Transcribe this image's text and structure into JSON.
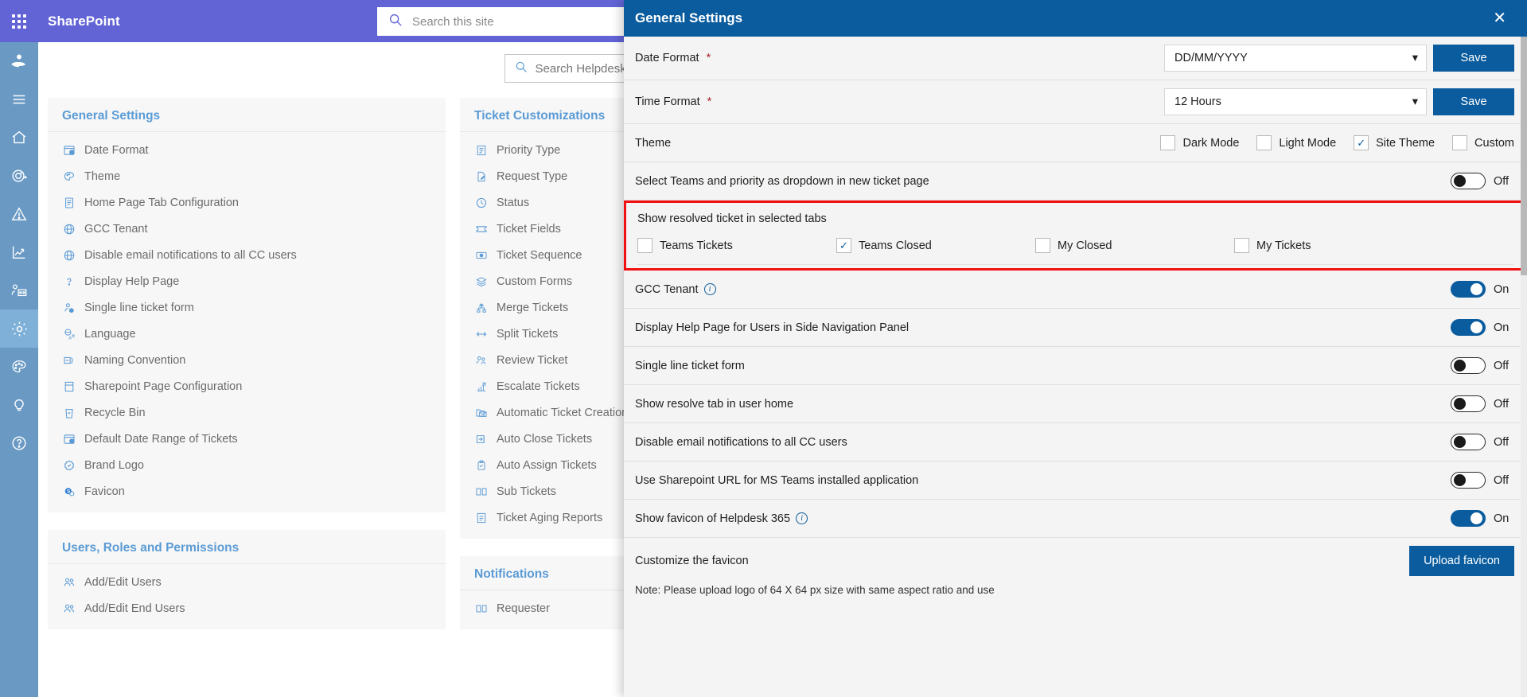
{
  "suitebar": {
    "waffle_name": "app-launcher",
    "brand": "SharePoint",
    "search_placeholder": "Search this site",
    "search_value": "",
    "bg": "#6264d6"
  },
  "rail": {
    "items": [
      {
        "name": "helpdesk-logo-icon",
        "label": "Helpdesk"
      },
      {
        "name": "hamburger-menu-icon",
        "label": "Menu"
      },
      {
        "name": "home-icon",
        "label": "Home"
      },
      {
        "name": "dashboard-gauge-icon",
        "label": "Dashboard"
      },
      {
        "name": "alert-triangle-icon",
        "label": "Alerts"
      },
      {
        "name": "analytics-chart-icon",
        "label": "Analytics"
      },
      {
        "name": "team-board-icon",
        "label": "Teams"
      },
      {
        "name": "gear-icon",
        "label": "Settings"
      },
      {
        "name": "palette-icon",
        "label": "Theme"
      },
      {
        "name": "lightbulb-icon",
        "label": "Tips"
      },
      {
        "name": "question-mark-icon",
        "label": "Help"
      }
    ],
    "active_index": 7,
    "bg": "#6a9ac4",
    "active_bg": "#7fb0d8"
  },
  "page_search": {
    "placeholder": "Search Helpdesk Settings",
    "value": ""
  },
  "settings_columns": [
    {
      "cards": [
        {
          "title": "General Settings",
          "items": [
            {
              "icon": "calendar-clock-icon",
              "label": "Date Format"
            },
            {
              "icon": "palette-icon",
              "label": "Theme"
            },
            {
              "icon": "document-list-icon",
              "label": "Home Page Tab Configuration"
            },
            {
              "icon": "globe-icon",
              "label": "GCC Tenant"
            },
            {
              "icon": "globe-icon",
              "label": "Disable email notifications to all CC users"
            },
            {
              "icon": "question-mark-icon",
              "label": "Display Help Page"
            },
            {
              "icon": "person-cancel-icon",
              "label": "Single line ticket form"
            },
            {
              "icon": "translate-icon",
              "label": "Language"
            },
            {
              "icon": "rename-icon",
              "label": "Naming Convention"
            },
            {
              "icon": "page-layout-icon",
              "label": "Sharepoint Page Configuration"
            },
            {
              "icon": "recycle-bin-icon",
              "label": "Recycle Bin"
            },
            {
              "icon": "calendar-clock-icon",
              "label": "Default Date Range of Tickets"
            },
            {
              "icon": "badge-check-icon",
              "label": "Brand Logo"
            },
            {
              "icon": "sharepoint-badge-icon",
              "label": "Favicon"
            }
          ]
        },
        {
          "title": "Users, Roles and Permissions",
          "items": [
            {
              "icon": "people-icon",
              "label": "Add/Edit Users"
            },
            {
              "icon": "people-icon",
              "label": "Add/Edit End Users"
            }
          ]
        }
      ]
    },
    {
      "cards": [
        {
          "title": "Ticket Customizations",
          "items": [
            {
              "icon": "priority-list-icon",
              "label": "Priority Type"
            },
            {
              "icon": "request-edit-icon",
              "label": "Request Type"
            },
            {
              "icon": "clock-check-icon",
              "label": "Status"
            },
            {
              "icon": "ticket-icon",
              "label": "Ticket Fields"
            },
            {
              "icon": "sequence-icon",
              "label": "Ticket Sequence"
            },
            {
              "icon": "layers-icon",
              "label": "Custom Forms"
            },
            {
              "icon": "merge-icon",
              "label": "Merge Tickets"
            },
            {
              "icon": "split-arrows-icon",
              "label": "Split Tickets"
            },
            {
              "icon": "review-person-icon",
              "label": "Review Ticket"
            },
            {
              "icon": "escalate-chart-icon",
              "label": "Escalate Tickets"
            },
            {
              "icon": "mail-folder-icon",
              "label": "Automatic Ticket Creation"
            },
            {
              "icon": "auto-close-icon",
              "label": "Auto Close Tickets"
            },
            {
              "icon": "auto-assign-icon",
              "label": "Auto Assign Tickets"
            },
            {
              "icon": "sub-tickets-icon",
              "label": "Sub Tickets"
            },
            {
              "icon": "aging-report-icon",
              "label": "Ticket Aging Reports"
            }
          ]
        },
        {
          "title": "Notifications",
          "items": [
            {
              "icon": "requester-icon",
              "label": "Requester"
            }
          ]
        }
      ]
    }
  ],
  "panel": {
    "title": "General Settings",
    "close_label": "✕",
    "accent": "#0a5c9e",
    "highlight_color": "#f21111",
    "rows": {
      "date_format": {
        "label": "Date Format",
        "required": "*",
        "value": "DD/MM/YYYY",
        "save_label": "Save"
      },
      "time_format": {
        "label": "Time Format",
        "required": "*",
        "value": "12 Hours",
        "save_label": "Save"
      },
      "theme": {
        "label": "Theme",
        "options": [
          {
            "label": "Dark Mode",
            "checked": false
          },
          {
            "label": "Light Mode",
            "checked": false
          },
          {
            "label": "Site Theme",
            "checked": true
          },
          {
            "label": "Custom",
            "checked": false
          }
        ]
      },
      "teams_priority_dropdown": {
        "label": "Select Teams and priority as dropdown in new ticket page",
        "state": "Off",
        "on": false
      },
      "show_resolved": {
        "label": "Show resolved ticket in selected tabs",
        "tabs": [
          {
            "label": "Teams Tickets",
            "checked": false
          },
          {
            "label": "Teams Closed",
            "checked": true
          },
          {
            "label": "My Closed",
            "checked": false
          },
          {
            "label": "My Tickets",
            "checked": false
          }
        ]
      },
      "gcc_tenant": {
        "label": "GCC Tenant",
        "has_info": true,
        "state": "On",
        "on": true
      },
      "display_help_page": {
        "label": "Display Help Page for Users in Side Navigation Panel",
        "has_info": false,
        "state": "On",
        "on": true
      },
      "single_line_form": {
        "label": "Single line ticket form",
        "has_info": false,
        "state": "Off",
        "on": false
      },
      "show_resolve_tab": {
        "label": "Show resolve tab in user home",
        "has_info": false,
        "state": "Off",
        "on": false
      },
      "disable_cc_email": {
        "label": "Disable email notifications to all CC users",
        "has_info": false,
        "state": "Off",
        "on": false
      },
      "sharepoint_url_teams": {
        "label": "Use Sharepoint URL for MS Teams installed application",
        "has_info": false,
        "state": "Off",
        "on": false
      },
      "show_favicon": {
        "label": "Show favicon of Helpdesk 365",
        "has_info": true,
        "state": "On",
        "on": true
      },
      "customize_favicon": {
        "label": "Customize the favicon",
        "upload_label": "Upload favicon",
        "note": "Note: Please upload logo of 64 X 64 px size with same aspect ratio and use"
      }
    }
  }
}
